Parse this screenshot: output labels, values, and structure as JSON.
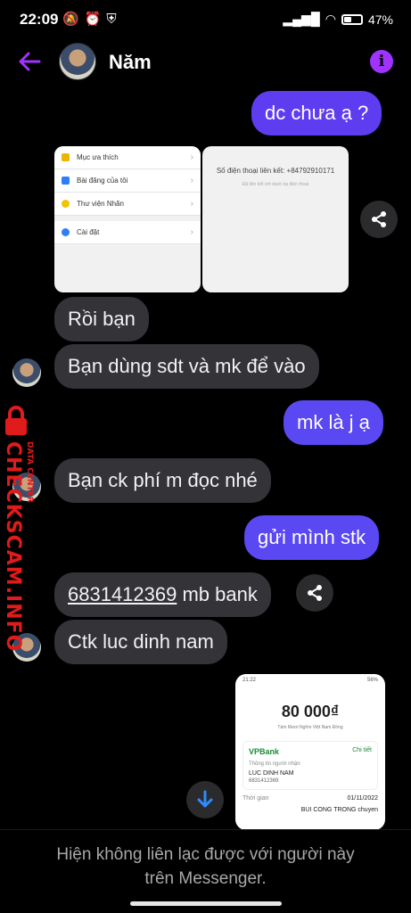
{
  "status": {
    "time": "22:09",
    "battery": "47%"
  },
  "header": {
    "name": "Năm"
  },
  "messages": {
    "m1": "dc chưa ạ ?",
    "m2": "Rồi bạn",
    "m3": "Bạn dùng sdt và mk để vào",
    "m4": "mk là j ạ",
    "m5": "Bạn ck phí m đọc nhé",
    "m6": "gửi mình stk",
    "m7_account": "6831412369",
    "m7_rest": " mb bank",
    "m8": "Ctk luc dinh nam"
  },
  "screenshot1": {
    "menu": [
      "Mục ưa thích",
      "Bài đăng của tôi",
      "Thư viện Nhãn",
      "Cài đặt"
    ],
    "phone_label": "Số điện thoại liên kết:",
    "phone": "+84792910171",
    "phone_note": "Đã liên kết với danh bạ điện thoại"
  },
  "receipt": {
    "status_time": "21:22",
    "status_batt": "56%",
    "amount": "80 000₫",
    "amount_words": "Tám Mươi Nghìn Việt Nam Đồng",
    "bank": "VPBank",
    "detail": "Chi tiết",
    "recipient_label": "Thông tin người nhận",
    "recipient_name": "LUC DINH NAM",
    "recipient_acc": "6831412369",
    "time_label": "Thời gian",
    "time_value": "01/11/2022",
    "sender": "BUI CONG TRONG chuyen"
  },
  "footer": {
    "text_line1": "Hiện không liên lạc được với người này",
    "text_line2": "trên Messenger."
  },
  "watermark": {
    "main": "CHECKSCAM.INFO",
    "small": "DATA CENTER"
  },
  "colors": {
    "accent": "#a033ff",
    "outgoing": "#5e3cf0",
    "incoming": "#333338"
  }
}
